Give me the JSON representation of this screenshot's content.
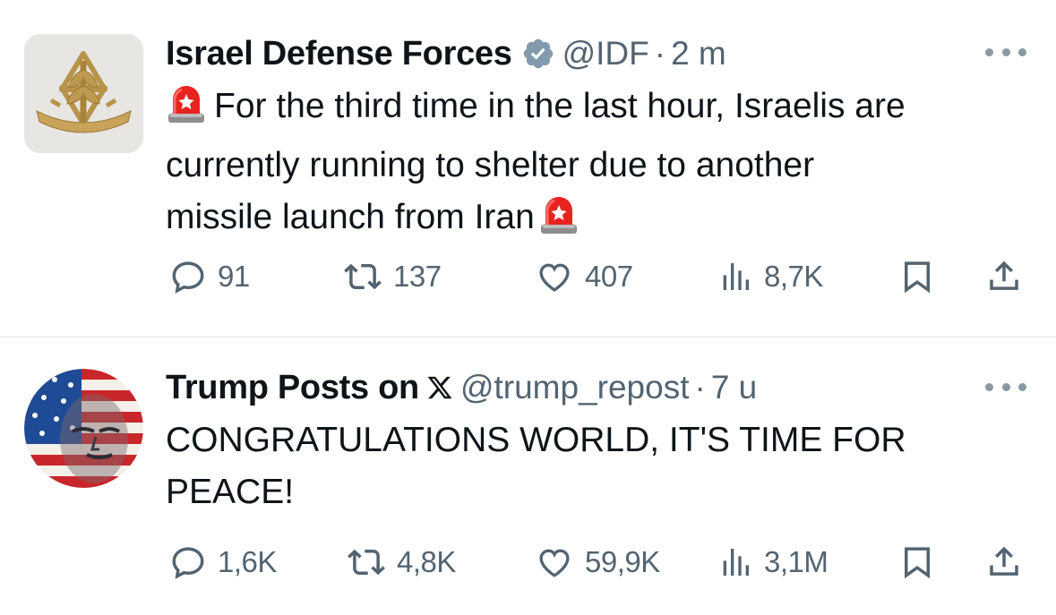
{
  "tweets": [
    {
      "display_name": "Israel Defense Forces",
      "verified": true,
      "handle": "@IDF",
      "separator": "·",
      "time": "2 m",
      "text_lines": [
        "For the third time in the last hour, Israelis are",
        "currently running to shelter due to another",
        "missile launch from Iran"
      ],
      "emoji_start": "rotating-light",
      "emoji_end": "rotating-light",
      "avatar": "idf-emblem",
      "stats": {
        "replies": "91",
        "reposts": "137",
        "likes": "407",
        "views": "8,7K"
      }
    },
    {
      "display_name": "Trump Posts on",
      "name_icon": "x-logo-icon",
      "handle": "@trump_repost",
      "separator": "·",
      "time": "7 u",
      "text_lines": [
        "CONGRATULATIONS WORLD, IT'S TIME FOR",
        "PEACE!"
      ],
      "avatar": "flag-face",
      "stats": {
        "replies": "1,6K",
        "reposts": "4,8K",
        "likes": "59,9K",
        "views": "3,1M"
      }
    }
  ],
  "colors": {
    "text": "#0f1419",
    "secondary": "#536471",
    "verified": "#829aab",
    "divider": "#e1e4e7"
  }
}
